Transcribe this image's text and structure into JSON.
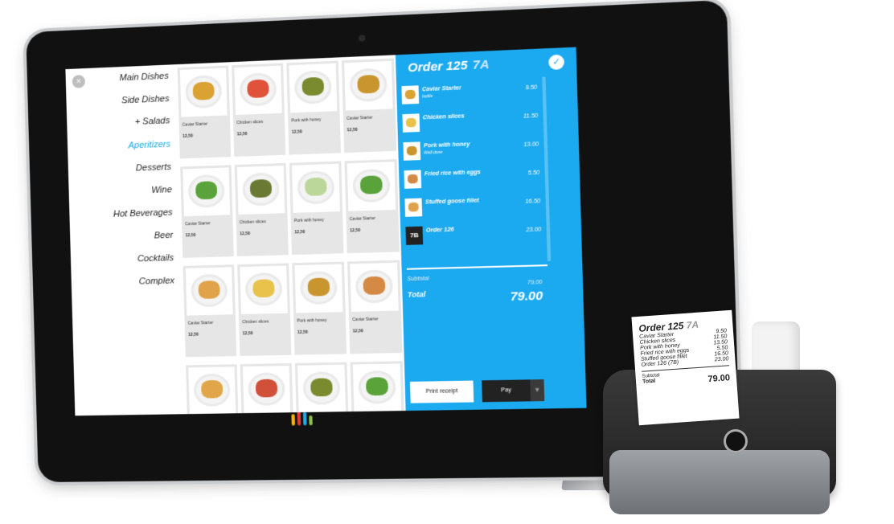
{
  "categories": {
    "close_label": "×",
    "items": [
      {
        "label": "Main Dishes"
      },
      {
        "label": "Side Dishes"
      },
      {
        "label": "+ Salads"
      },
      {
        "label": "Aperitizers",
        "active": true
      },
      {
        "label": "Desserts"
      },
      {
        "label": "Wine"
      },
      {
        "label": "Hot Beverages"
      },
      {
        "label": "Beer"
      },
      {
        "label": "Cocktails"
      },
      {
        "label": "Complex"
      }
    ]
  },
  "menu_tiles": [
    {
      "name": "Caviar Starter",
      "price": "12,50",
      "food_color": "#d9a233"
    },
    {
      "name": "Chicken slices",
      "price": "12,50",
      "food_color": "#e0523a"
    },
    {
      "name": "Pork with honey",
      "price": "12,50",
      "food_color": "#7a8a2e"
    },
    {
      "name": "Caviar Starter",
      "price": "12,50",
      "food_color": "#c9952e"
    },
    {
      "name": "Caviar Starter",
      "price": "12,50",
      "food_color": "#5aa23a"
    },
    {
      "name": "Chicken slices",
      "price": "12,50",
      "food_color": "#6a7a34"
    },
    {
      "name": "Pork with honey",
      "price": "12,50",
      "food_color": "#bcd79a"
    },
    {
      "name": "Caviar Starter",
      "price": "12,50",
      "food_color": "#5aa23a"
    },
    {
      "name": "Caviar Starter",
      "price": "12,50",
      "food_color": "#e0a34a"
    },
    {
      "name": "Chicken slices",
      "price": "12,50",
      "food_color": "#e8c24a"
    },
    {
      "name": "Pork with honey",
      "price": "12,50",
      "food_color": "#c9952e"
    },
    {
      "name": "Caviar Starter",
      "price": "12,50",
      "food_color": "#d48a44"
    },
    {
      "name": "",
      "price": "",
      "food_color": "#e2a64a"
    },
    {
      "name": "",
      "price": "",
      "food_color": "#d0503a"
    },
    {
      "name": "",
      "price": "",
      "food_color": "#7a8a2e"
    },
    {
      "name": "",
      "price": "",
      "food_color": "#5aa23a"
    }
  ],
  "order": {
    "title": "Order 125",
    "table": "7A",
    "items": [
      {
        "name": "Caviar Starter",
        "sub": "bottle",
        "price": "9.50",
        "food_color": "#d9a233"
      },
      {
        "name": "Chicken slices",
        "sub": "",
        "price": "11.50",
        "food_color": "#e8c24a"
      },
      {
        "name": "Pork with honey",
        "sub": "Well done",
        "price": "13.00",
        "food_color": "#c9952e"
      },
      {
        "name": "Fried rice with eggs",
        "sub": "",
        "price": "5.50",
        "food_color": "#d48a44"
      },
      {
        "name": "Stuffed goose fillet",
        "sub": "",
        "price": "16.50",
        "food_color": "#e0a34a"
      }
    ],
    "linked_order": {
      "badge": "7B",
      "name": "Order 126",
      "price": "23.00"
    },
    "subtotal_label": "Subtotal",
    "subtotal_value": "79.00",
    "total_label": "Total",
    "total_value": "79.00",
    "print_label": "Print receipt",
    "pay_label": "Pay",
    "pay_dropdown": "▼"
  },
  "receipt": {
    "title": "Order 125",
    "table": "7A",
    "rows": [
      {
        "name": "Caviar Starter",
        "price": "9.50"
      },
      {
        "name": "Chicken slices",
        "price": "11.50"
      },
      {
        "name": "Pork with honey",
        "price": "13.50"
      },
      {
        "name": "Fried rice with eggs",
        "price": "5.50"
      },
      {
        "name": "Stuffed goose fillet",
        "price": "16.50"
      },
      {
        "name": "Order 126 (7B)",
        "price": "23.00"
      }
    ],
    "subtotal_label": "Subtotal",
    "total_label": "Total",
    "total_value": "79.00"
  },
  "colors": {
    "accent": "#1ba9ef",
    "dark": "#222222"
  }
}
